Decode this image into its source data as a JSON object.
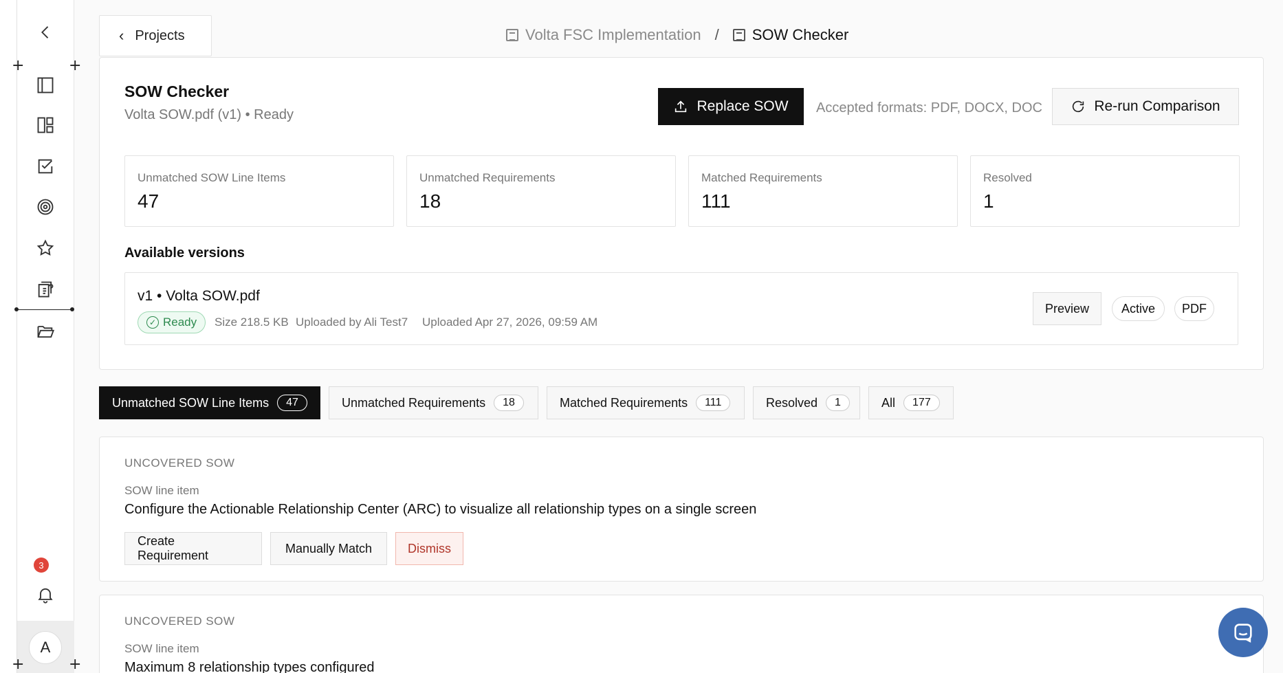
{
  "sidebar": {
    "notification_count": "3",
    "avatar_initial": "A"
  },
  "header": {
    "back_label": "Projects",
    "breadcrumb_parent": "Volta FSC Implementation",
    "breadcrumb_separator": "/",
    "breadcrumb_current": "SOW Checker"
  },
  "checker": {
    "title": "SOW Checker",
    "subtitle": "Volta SOW.pdf (v1) • Ready",
    "replace_label": "Replace SOW",
    "accepted_formats": "Accepted formats: PDF, DOCX, DOC",
    "rerun_label": "Re-run Comparison"
  },
  "stats": [
    {
      "label": "Unmatched SOW Line Items",
      "value": "47"
    },
    {
      "label": "Unmatched Requirements",
      "value": "18"
    },
    {
      "label": "Matched Requirements",
      "value": "111"
    },
    {
      "label": "Resolved",
      "value": "1"
    }
  ],
  "versions": {
    "title": "Available versions",
    "items": [
      {
        "name": "v1 • Volta SOW.pdf",
        "status": "Ready",
        "size": "Size 218.5 KB",
        "uploaded_by": "Uploaded by Ali Test7",
        "uploaded_at": "Uploaded Apr 27, 2026, 09:59 AM",
        "preview_label": "Preview",
        "active_label": "Active",
        "format_label": "PDF"
      }
    ]
  },
  "tabs": [
    {
      "label": "Unmatched SOW Line Items",
      "count": "47"
    },
    {
      "label": "Unmatched Requirements",
      "count": "18"
    },
    {
      "label": "Matched Requirements",
      "count": "111"
    },
    {
      "label": "Resolved",
      "count": "1"
    },
    {
      "label": "All",
      "count": "177"
    }
  ],
  "items": [
    {
      "kind": "UNCOVERED SOW",
      "sub_label": "SOW line item",
      "description": "Configure the Actionable Relationship Center (ARC) to visualize all relationship types on a single screen",
      "create_label": "Create Requirement",
      "match_label": "Manually Match",
      "dismiss_label": "Dismiss"
    },
    {
      "kind": "UNCOVERED SOW",
      "sub_label": "SOW line item",
      "description": "Maximum 8 relationship types configured"
    }
  ],
  "colors": {
    "accent_dark": "#111111",
    "ready_green": "#2e8a4f",
    "danger": "#b0362a",
    "chat_blue": "#3f6db3",
    "badge_red": "#e0453a"
  }
}
